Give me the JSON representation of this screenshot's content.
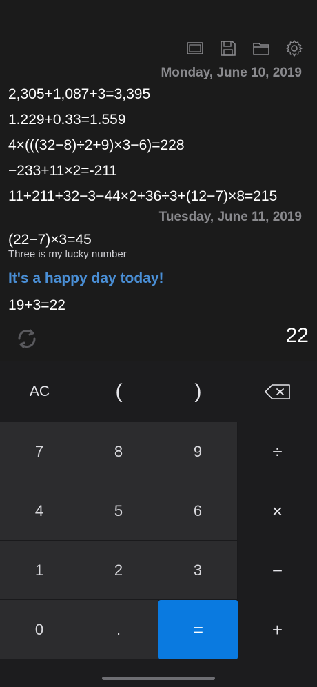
{
  "toolbar": {
    "icons": [
      "screen-icon",
      "save-icon",
      "folder-icon",
      "gear-icon"
    ]
  },
  "history": {
    "groups": [
      {
        "date": "Monday, June 10, 2019",
        "lines": [
          "2,305+1,087+3=3,395",
          "1.229+0.33=1.559",
          "4×(((32−8)÷2+9)×3−6)=228",
          "−233+11×2=-211",
          "11+211+32−3−44×2+36÷3+(12−7)×8=215"
        ]
      },
      {
        "date": "Tuesday, June 11, 2019",
        "line1": "(22−7)×3=45",
        "note": "Three is my lucky number",
        "headline": "It's a happy day today!",
        "line2": "19+3=22"
      }
    ]
  },
  "result": "22",
  "keys": {
    "ac": "AC",
    "lparen": "(",
    "rparen": ")",
    "k7": "7",
    "k8": "8",
    "k9": "9",
    "div": "÷",
    "k4": "4",
    "k5": "5",
    "k6": "6",
    "mul": "×",
    "k1": "1",
    "k2": "2",
    "k3": "3",
    "sub": "−",
    "k0": "0",
    "dot": ".",
    "eq": "=",
    "add": "+"
  },
  "colors": {
    "accent": "#0a7ae0",
    "headline": "#4a8fd6",
    "background": "#1b1b1b"
  }
}
